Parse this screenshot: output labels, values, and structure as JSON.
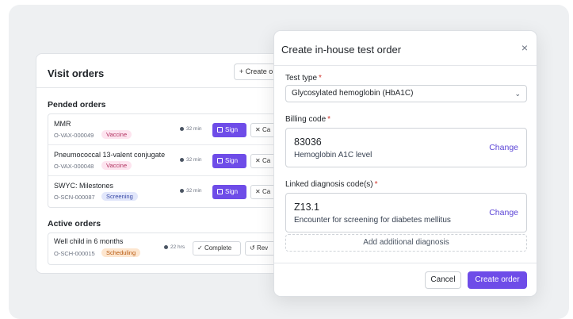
{
  "visit_orders": {
    "title": "Visit orders",
    "create_label": "+ Create o",
    "pended_title": "Pended orders",
    "active_title": "Active orders",
    "pended": [
      {
        "name": "MMR",
        "id": "O-VAX-000049",
        "tag": "Vaccine",
        "tag_type": "vaccine",
        "time": "32 min",
        "sign": "Sign",
        "cancel": "Ca"
      },
      {
        "name": "Pneumococcal 13-valent conjugate",
        "id": "O-VAX-000048",
        "tag": "Vaccine",
        "tag_type": "vaccine",
        "time": "32 min",
        "sign": "Sign",
        "cancel": "Ca"
      },
      {
        "name": "SWYC: Milestones",
        "id": "O-SCN-000087",
        "tag": "Screening",
        "tag_type": "screening",
        "time": "32 min",
        "sign": "Sign",
        "cancel": "Ca"
      }
    ],
    "active": [
      {
        "name": "Well child in 6 months",
        "id": "O-SCH-000015",
        "tag": "Scheduling",
        "tag_type": "scheduling",
        "time": "22 hrs",
        "complete": "Complete",
        "rev": "Rev"
      }
    ]
  },
  "modal": {
    "title": "Create in-house test order",
    "close_icon": "close-icon",
    "test_type": {
      "label": "Test type",
      "value": "Glycosylated hemoglobin (HbA1C)"
    },
    "billing": {
      "label": "Billing code",
      "code": "83036",
      "description": "Hemoglobin A1C level",
      "change": "Change"
    },
    "diagnosis": {
      "label": "Linked diagnosis code(s)",
      "code": "Z13.1",
      "description": "Encounter for screening for diabetes mellitus",
      "change": "Change"
    },
    "add_diagnosis": "Add additional diagnosis",
    "cancel": "Cancel",
    "create": "Create order"
  },
  "colors": {
    "accent": "#6e4ce8",
    "link": "#5b44d6",
    "required": "#d0342c"
  }
}
